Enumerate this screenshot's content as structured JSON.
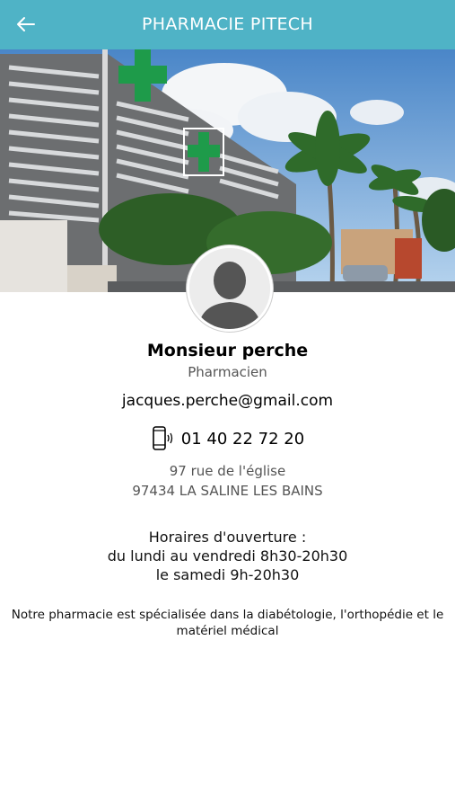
{
  "header": {
    "back_icon": "arrow-left-icon",
    "title": "PHARMACIE PITECH",
    "background_color": "#4fb3c6"
  },
  "profile": {
    "avatar_icon": "person-silhouette-icon",
    "name": "Monsieur perche",
    "role": "Pharmacien",
    "email": "jacques.perche@gmail.com",
    "phone_icon": "mobile-phone-icon",
    "phone": "01 40 22 72 20"
  },
  "address": {
    "line1": "97 rue de l'église",
    "line2": "97434 LA SALINE LES BAINS"
  },
  "hours": {
    "title": "Horaires d'ouverture :",
    "weekdays": "du lundi au vendredi 8h30-20h30",
    "saturday": "le samedi 9h-20h30"
  },
  "description": "Notre pharmacie est spécialisée dans la diabétologie, l'orthopédie et le matériel médical"
}
